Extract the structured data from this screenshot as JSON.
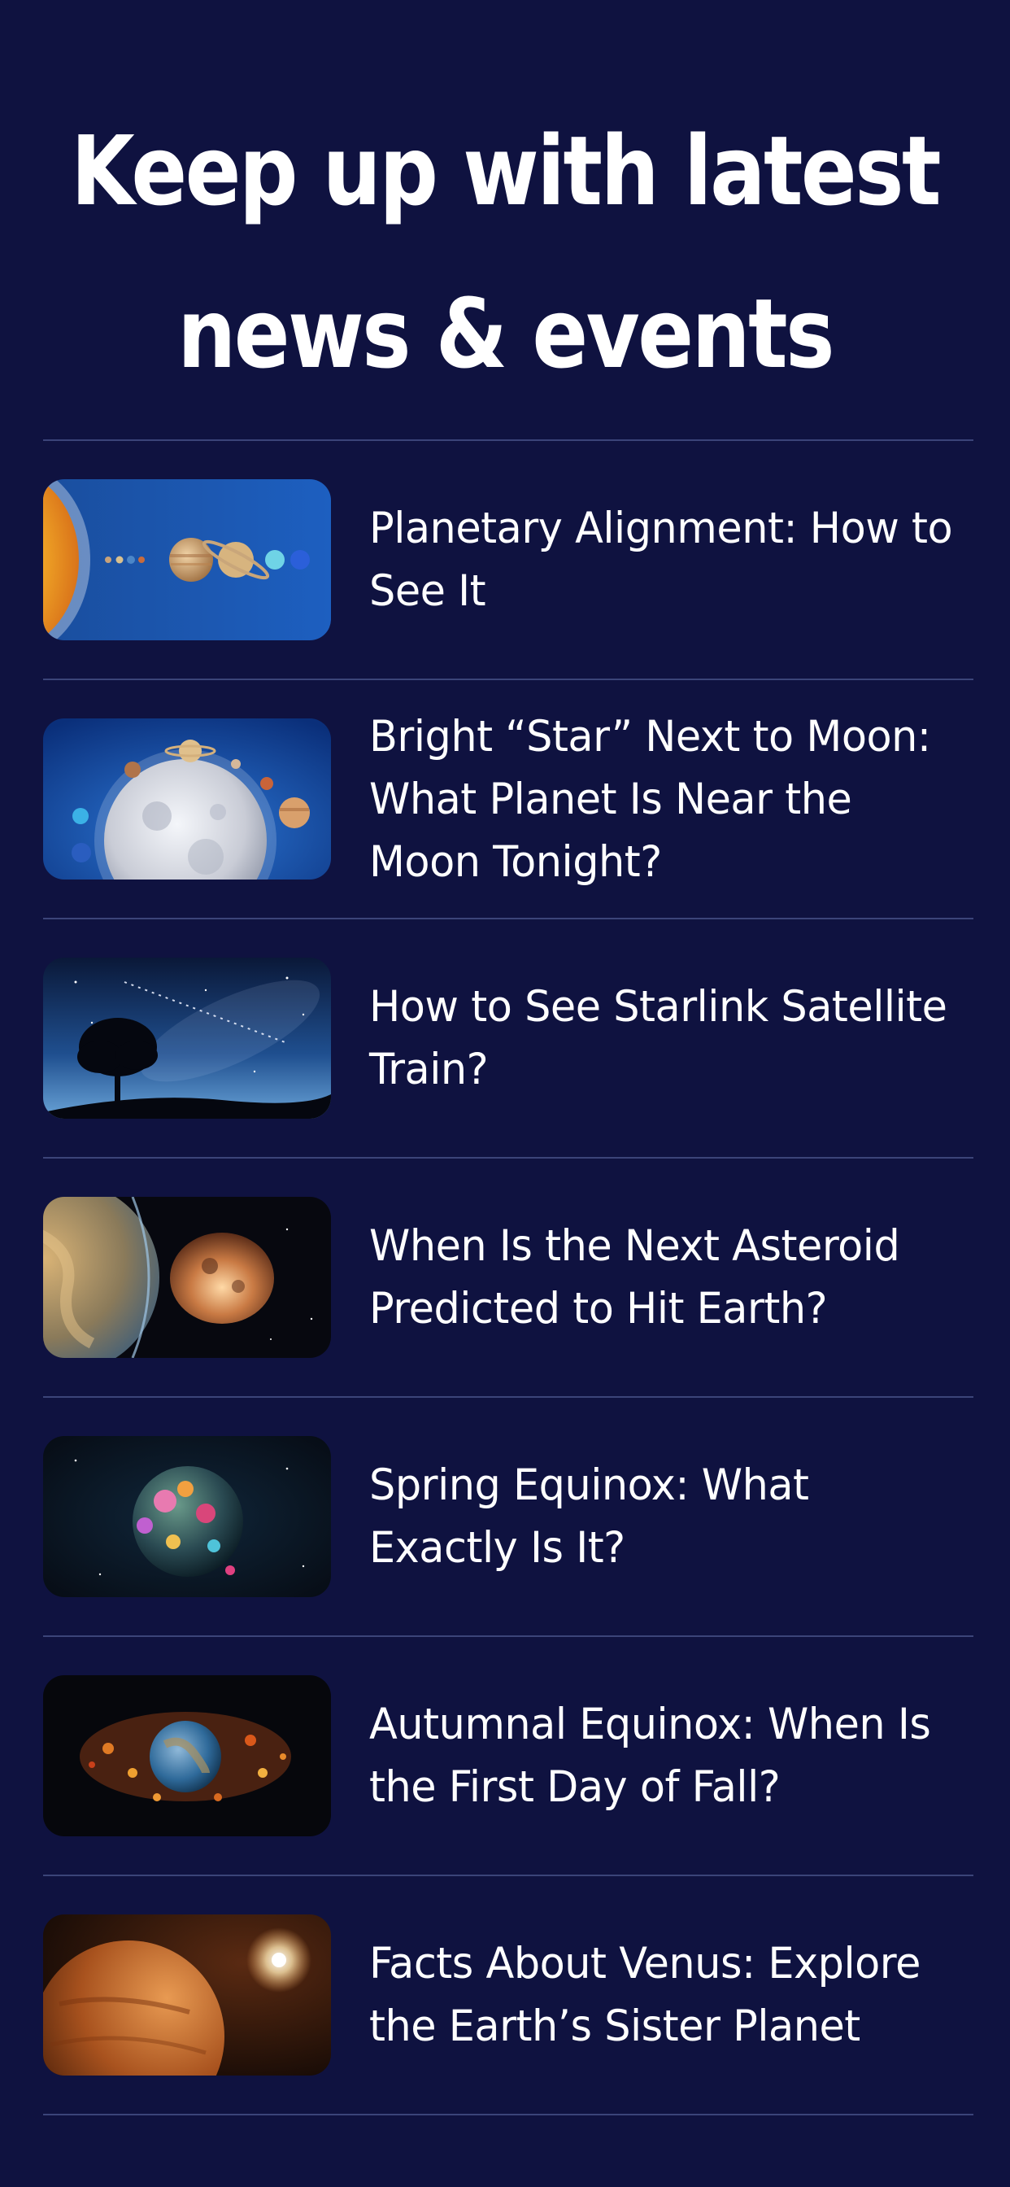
{
  "header": {
    "title_line1": "Keep up with latest",
    "title_line2": "news & events"
  },
  "colors": {
    "background": "#0f1240",
    "divider": "#3b4479",
    "text": "#ffffff"
  },
  "articles": [
    {
      "title": "Planetary Alignment: How to See It",
      "image": "planetary-alignment-image"
    },
    {
      "title": "Bright “Star” Next to Moon: What Planet Is Near the Moon Tonight?",
      "image": "moon-and-planets-image"
    },
    {
      "title": "How to See Starlink Satellite Train?",
      "image": "starlink-night-sky-image"
    },
    {
      "title": "When Is the Next Asteroid Predicted to Hit Earth?",
      "image": "asteroid-earth-image"
    },
    {
      "title": "Spring Equinox: What Exactly Is It?",
      "image": "flower-planet-image"
    },
    {
      "title": "Autumnal Equinox: When Is the First Day of Fall?",
      "image": "autumn-earth-image"
    },
    {
      "title": "Facts About Venus: Explore the Earth’s Sister Planet",
      "image": "venus-image"
    }
  ]
}
